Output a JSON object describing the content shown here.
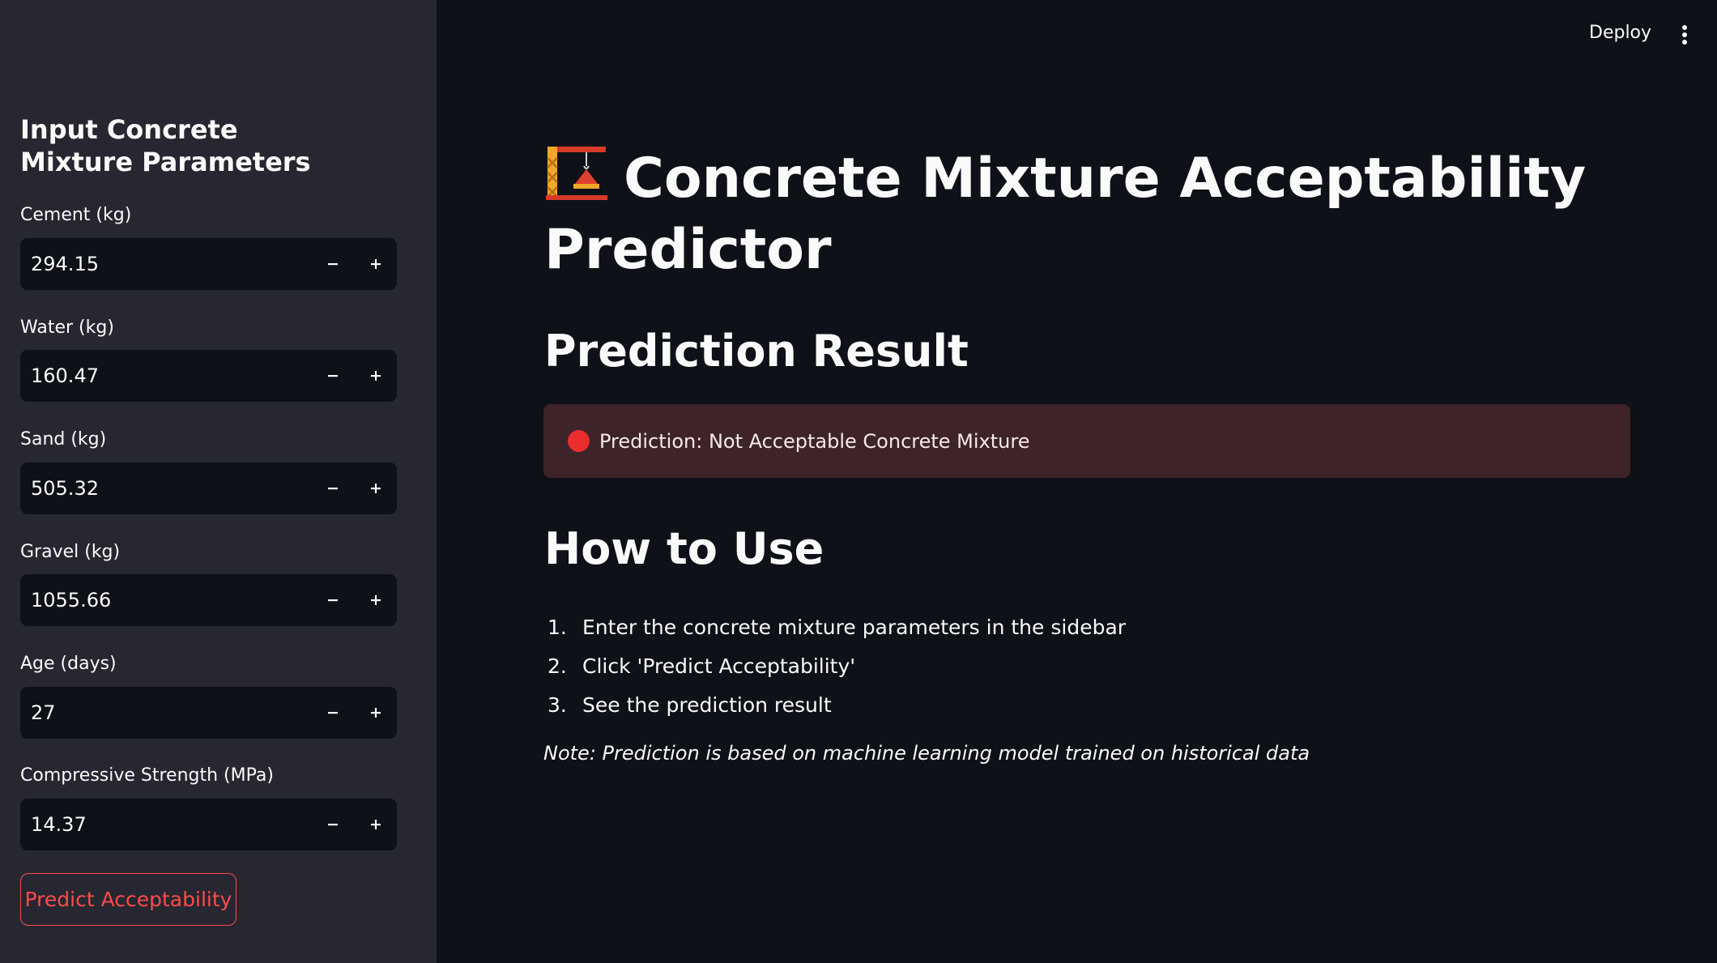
{
  "header": {
    "deploy_label": "Deploy",
    "menu_icon": "more-vert-icon"
  },
  "sidebar": {
    "title": "Input Concrete Mixture Parameters",
    "fields": [
      {
        "label": "Cement (kg)",
        "value": "294.15"
      },
      {
        "label": "Water (kg)",
        "value": "160.47"
      },
      {
        "label": "Sand (kg)",
        "value": "505.32"
      },
      {
        "label": "Gravel (kg)",
        "value": "1055.66"
      },
      {
        "label": "Age (days)",
        "value": "27"
      },
      {
        "label": "Compressive Strength (MPa)",
        "value": "14.37"
      }
    ],
    "predict_button": "Predict Acceptability"
  },
  "main": {
    "title": "Concrete Mixture Acceptability Predictor",
    "title_icon": "construction-crane-icon",
    "result_heading": "Prediction Result",
    "alert_text": "Prediction: Not Acceptable Concrete Mixture",
    "howto_heading": "How to Use",
    "steps": [
      {
        "num": "1.",
        "text": "Enter the concrete mixture parameters in the sidebar"
      },
      {
        "num": "2.",
        "text": "Click 'Predict Acceptability'"
      },
      {
        "num": "3.",
        "text": "See the prediction result"
      }
    ],
    "note": "Note: Prediction is based on machine learning model trained on historical data"
  },
  "colors": {
    "background": "#0e1117",
    "sidebar": "#262730",
    "accent": "#ff4b4b",
    "alert_bg": "#3e2428"
  }
}
